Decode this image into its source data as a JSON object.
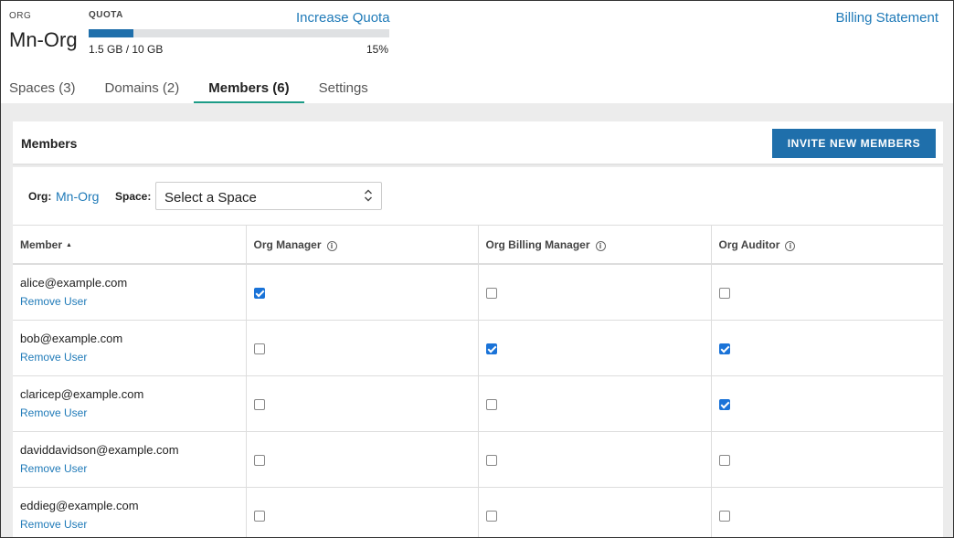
{
  "header": {
    "org_caption": "ORG",
    "org_name": "Mn-Org",
    "quota_caption": "QUOTA",
    "increase_quota": "Increase Quota",
    "quota_used": "1.5 GB / 10 GB",
    "quota_percent": "15%",
    "quota_fraction": 0.15,
    "billing_statement": "Billing Statement"
  },
  "tabs": [
    {
      "label": "Spaces (3)",
      "active": false
    },
    {
      "label": "Domains (2)",
      "active": false
    },
    {
      "label": "Members (6)",
      "active": true
    },
    {
      "label": "Settings",
      "active": false
    }
  ],
  "panel": {
    "title": "Members",
    "invite_button": "INVITE NEW MEMBERS"
  },
  "filters": {
    "org_label": "Org:",
    "org_value": "Mn-Org",
    "space_label": "Space:",
    "space_value": "Select a Space"
  },
  "table": {
    "columns": [
      "Member",
      "Org Manager",
      "Org Billing Manager",
      "Org Auditor"
    ],
    "remove_label": "Remove User",
    "rows": [
      {
        "email": "alice@example.com",
        "org_manager": true,
        "billing_manager": false,
        "auditor": false
      },
      {
        "email": "bob@example.com",
        "org_manager": false,
        "billing_manager": true,
        "auditor": true
      },
      {
        "email": "claricep@example.com",
        "org_manager": false,
        "billing_manager": false,
        "auditor": true
      },
      {
        "email": "daviddavidson@example.com",
        "org_manager": false,
        "billing_manager": false,
        "auditor": false
      },
      {
        "email": "eddieg@example.com",
        "org_manager": false,
        "billing_manager": false,
        "auditor": false
      }
    ]
  },
  "colors": {
    "accent": "#1f6fab",
    "link": "#1f7ab8",
    "tab_underline": "#1c9c87",
    "checkbox": "#1a73d8"
  }
}
